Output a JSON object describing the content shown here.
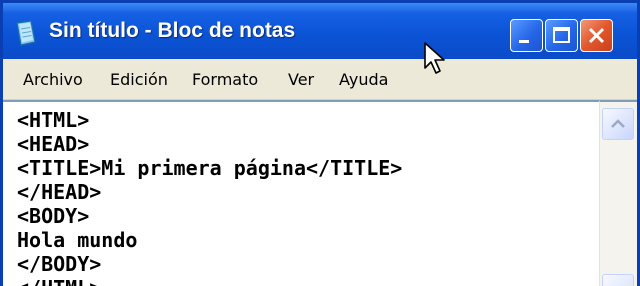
{
  "window": {
    "title": "Sin título - Bloc de notas"
  },
  "menu": {
    "items": [
      "Archivo",
      "Edición",
      "Formato",
      "Ver",
      "Ayuda"
    ]
  },
  "editor": {
    "content": "<HTML>\n<HEAD>\n<TITLE>Mi primera página</TITLE>\n</HEAD>\n<BODY>\nHola mundo\n</BODY>\n</HTML>"
  },
  "icons": {
    "app": "notepad-icon",
    "minimize": "minimize-icon",
    "maximize": "maximize-icon",
    "close": "close-icon",
    "scroll_up": "scroll-up-arrow-icon",
    "pointer": "mouse-pointer-icon"
  },
  "colors": {
    "titlebar": "#0b54d6",
    "close_button": "#e2572c",
    "menubar": "#ece9d8",
    "editor_bg": "#ffffff"
  }
}
